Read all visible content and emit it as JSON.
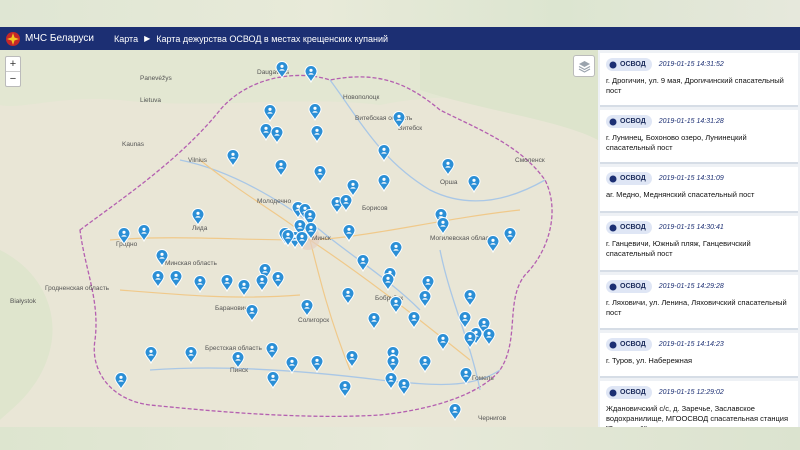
{
  "navbar": {
    "brand": "МЧС Беларуси",
    "breadcrumb": [
      "Карта",
      "Карта дежурства ОСВОД в местах крещенских купаний"
    ]
  },
  "map": {
    "zoom_in": "+",
    "zoom_out": "−",
    "labels": [
      {
        "text": "Daugavpils"
      },
      {
        "text": "Lietuva"
      },
      {
        "text": "Panevėžys"
      },
      {
        "text": "Kaunas"
      },
      {
        "text": "Vilnius"
      },
      {
        "text": "Новополоцк"
      },
      {
        "text": "Витебск"
      },
      {
        "text": "Орша"
      },
      {
        "text": "Смоленск"
      },
      {
        "text": "Молодечно"
      },
      {
        "text": "Минск"
      },
      {
        "text": "Борисов"
      },
      {
        "text": "Лида"
      },
      {
        "text": "Гродно"
      },
      {
        "text": "Могилевская область"
      },
      {
        "text": "Барановичи"
      },
      {
        "text": "Бобруйск"
      },
      {
        "text": "Солигорск"
      },
      {
        "text": "Пинск"
      },
      {
        "text": "Гомель"
      },
      {
        "text": "Брестская область"
      },
      {
        "text": "Минская область"
      },
      {
        "text": "Витебская область"
      },
      {
        "text": "Гродненская область"
      },
      {
        "text": "Białystok"
      },
      {
        "text": "Чернигов"
      }
    ],
    "marker_color": "#2b8fd6"
  },
  "panel": {
    "items": [
      {
        "badge": "ОСВОД",
        "time": "2019-01-15 14:31:52",
        "text": "г. Дрогичин, ул. 9 мая, Дрогичинский спасательный пост"
      },
      {
        "badge": "ОСВОД",
        "time": "2019-01-15 14:31:28",
        "text": "г. Лунинец, Бохоново озеро, Лунинецкий спасательный пост"
      },
      {
        "badge": "ОСВОД",
        "time": "2019-01-15 14:31:09",
        "text": "аг. Медно, Меднянский спасательный пост"
      },
      {
        "badge": "ОСВОД",
        "time": "2019-01-15 14:30:41",
        "text": "г. Ганцевичи, Южный пляж, Ганцевичский спасательный пост"
      },
      {
        "badge": "ОСВОД",
        "time": "2019-01-15 14:29:28",
        "text": "г. Ляховичи, ул. Ленина, Ляховичский спасательный пост"
      },
      {
        "badge": "ОСВОД",
        "time": "2019-01-15 14:14:23",
        "text": "г. Туров, ул. Набережная"
      },
      {
        "badge": "ОСВОД",
        "time": "2019-01-15 12:29:02",
        "text": "Ждановичский с/с, д. Заречье, Заславское водохранилище, МГООСВОД спасательная станция \"Заречье-1\""
      }
    ]
  }
}
